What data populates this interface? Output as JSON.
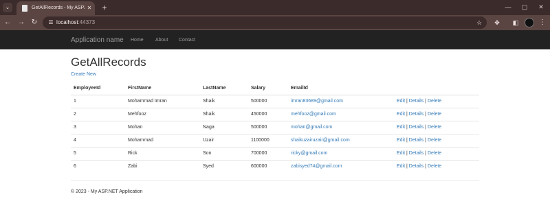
{
  "browser": {
    "tab_title": "GetAllRecords - My ASP.NET Ap",
    "tab_close": "✕",
    "new_tab": "+",
    "url_host": "localhost",
    "url_port": ":44373",
    "icons": [
      "tab-list-icon",
      "favicon-icon",
      "back-icon",
      "forward-icon",
      "reload-icon",
      "site-info-icon",
      "star-icon",
      "extensions-icon",
      "split-view-icon",
      "profile-avatar",
      "menu-icon",
      "minimize-icon",
      "maximize-icon",
      "close-window-icon"
    ]
  },
  "navbar": {
    "brand": "Application name",
    "links": [
      "Home",
      "About",
      "Contact"
    ]
  },
  "page": {
    "title": "GetAllRecords",
    "create_new": "Create New"
  },
  "table": {
    "headers": [
      "EmployeeId",
      "FirstName",
      "LastName",
      "Salary",
      "EmailId"
    ],
    "action_labels": [
      "Edit",
      "Details",
      "Delete"
    ],
    "separator": "|",
    "rows": [
      {
        "id": "1",
        "first": "Mohammad Imran",
        "last": "Shaik",
        "salary": "500000",
        "email": "imran83689@gmail.com"
      },
      {
        "id": "2",
        "first": "Mehfooz",
        "last": "Shaik",
        "salary": "450000",
        "email": "mehfooz@gmail.com"
      },
      {
        "id": "3",
        "first": "Mohan",
        "last": "Naga",
        "salary": "500000",
        "email": "mohan@gmail.com"
      },
      {
        "id": "4",
        "first": "Mohammad",
        "last": "Uzair",
        "salary": "1100000",
        "email": "shaikuzairuzair@gmail.com"
      },
      {
        "id": "5",
        "first": "Rick",
        "last": "Son",
        "salary": "700000",
        "email": "ricky@gmail.com"
      },
      {
        "id": "6",
        "first": "Zabi",
        "last": "Syed",
        "salary": "600000",
        "email": "zabisyed74@gmail.com"
      }
    ]
  },
  "footer": {
    "text": "© 2023 - My ASP.NET Application"
  },
  "colors": {
    "navbar_bg": "#222222",
    "nav_text": "#9d9d9d",
    "link": "#337ab7",
    "chrome_frame": "#3b2b2a",
    "chrome_toolbar": "#5b4543"
  }
}
